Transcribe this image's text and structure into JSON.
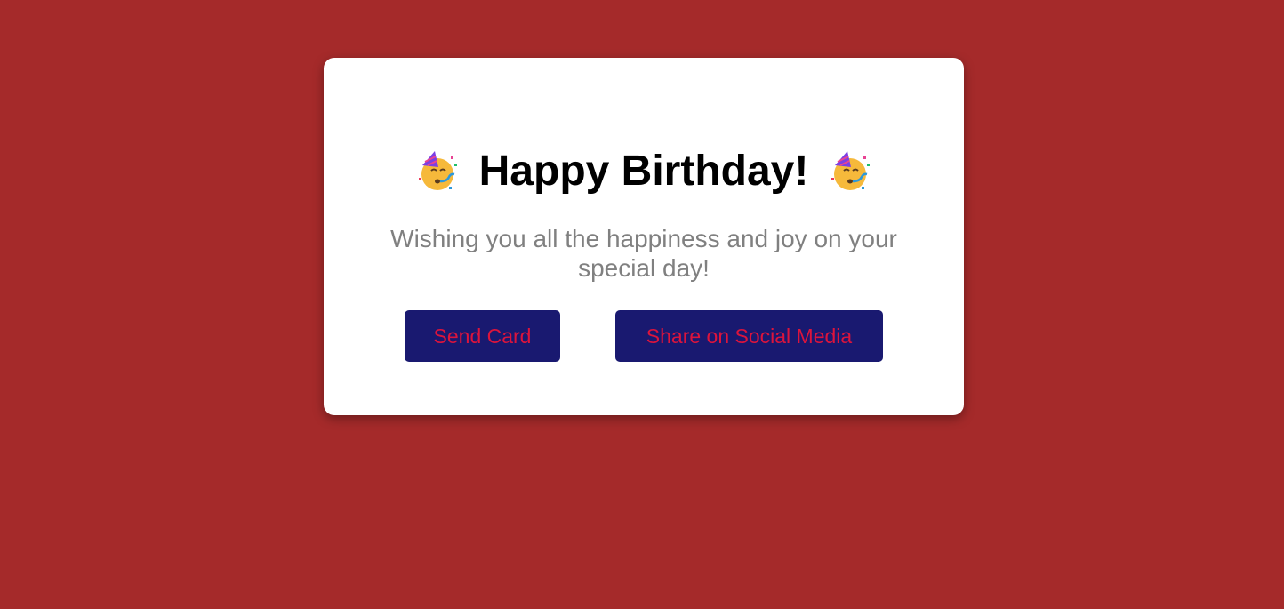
{
  "card": {
    "title": "Happy Birthday!",
    "title_icon": "partying-face-icon",
    "message": "Wishing you all the happiness and joy on your special day!",
    "buttons": {
      "send_label": "Send Card",
      "share_label": "Share on Social Media"
    }
  },
  "colors": {
    "background": "#a52a2a",
    "card": "#ffffff",
    "button_bg": "#191970",
    "button_text": "#dc143c",
    "message_text": "#808080"
  }
}
